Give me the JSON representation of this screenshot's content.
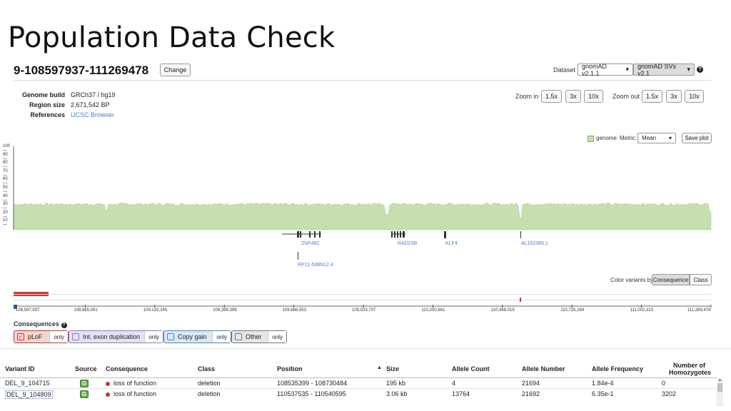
{
  "slide_title": "Population Data Check",
  "region": {
    "title": "9-108597937-111269478",
    "change_label": "Change"
  },
  "dataset": {
    "label": "Dataset",
    "option1": "gnomAD v2.1.1",
    "option2": "gnomAD SVs v2.1",
    "help": "?"
  },
  "meta": {
    "build_key": "Genome build",
    "build_val": "GRCh37 / hg19",
    "size_key": "Region size",
    "size_val": "2,671,542 BP",
    "refs_key": "References",
    "refs_val": "UCSC Browser"
  },
  "zoom": {
    "in_label": "Zoom in",
    "out_label": "Zoom out",
    "levels": [
      "1.5x",
      "3x",
      "10x"
    ]
  },
  "coverage": {
    "legend": "genome",
    "metric_label": "Metric:",
    "metric_value": "Mean",
    "save": "Save plot",
    "yticks": [
      "100",
      "90",
      "80",
      "70",
      "60",
      "50",
      "40",
      "30",
      "20",
      "10"
    ],
    "fill_color": "#c5dfae"
  },
  "genes": [
    "ZNF462",
    "RAD23B",
    "KLF4",
    "AL162389.1",
    "RP11-508N12.4"
  ],
  "color_by": {
    "label": "Color variants by",
    "consequence": "Consequence",
    "class": "Class"
  },
  "positions": [
    "108,597,937",
    "108,865,091",
    "109,132,245",
    "109,399,399",
    "109,666,553",
    "109,933,707",
    "110,200,861",
    "110,468,015",
    "110,735,169",
    "111,002,323",
    "111,269,478"
  ],
  "consequences": {
    "title": "Consequences",
    "items": [
      {
        "label": "pLoF",
        "only": "only",
        "color": "#c0392b"
      },
      {
        "label": "Int. exon duplication",
        "only": "only",
        "color": "#8e7cc3"
      },
      {
        "label": "Copy gain",
        "only": "only",
        "color": "#4a86c5"
      },
      {
        "label": "Other",
        "only": "only",
        "color": "#777777"
      }
    ]
  },
  "table": {
    "headers": [
      "Variant ID",
      "Source",
      "Consequence",
      "Class",
      "Position",
      "Size",
      "Allele Count",
      "Allele Number",
      "Allele Frequency",
      "Number of",
      "Homozygotes"
    ],
    "sort_arrow": "▲",
    "rows": [
      {
        "id": "DEL_9_104715",
        "source": "G",
        "consequence": "loss of function",
        "class": "deletion",
        "position": "108535399 - 108730484",
        "size": "195 kb",
        "ac": "4",
        "an": "21694",
        "af": "1.84e-4",
        "hom": "0"
      },
      {
        "id": "DEL_9_104809",
        "source": "G",
        "consequence": "loss of function",
        "class": "deletion",
        "position": "110537535 - 110540595",
        "size": "3.06 kb",
        "ac": "13764",
        "an": "21692",
        "af": "6.35e-1",
        "hom": "3202"
      }
    ]
  }
}
